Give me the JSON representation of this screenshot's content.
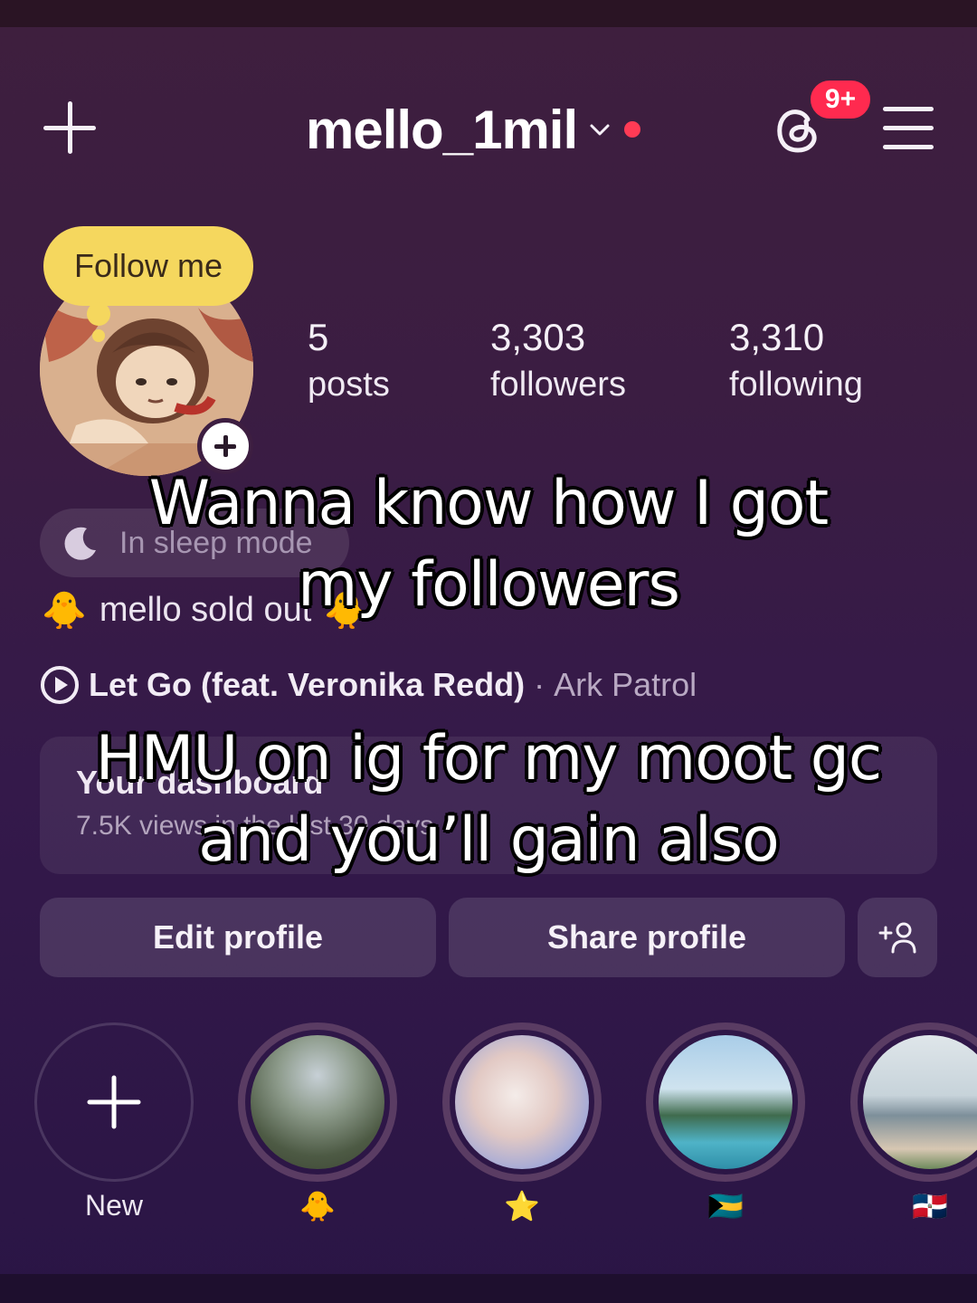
{
  "header": {
    "username": "mello_1mil",
    "threads_badge": "9+"
  },
  "note": {
    "text": "Follow me"
  },
  "stats": {
    "posts_count": "5",
    "posts_label": "posts",
    "followers_count": "3,303",
    "followers_label": "followers",
    "following_count": "3,310",
    "following_label": "following"
  },
  "status": {
    "sleep_text": "In sleep mode"
  },
  "bio": {
    "emoji_left": "🐥",
    "text": "mello sold out",
    "emoji_right": "🐥"
  },
  "music": {
    "song": "Let Go (feat. Veronika Redd)",
    "separator": "·",
    "artist": "Ark Patrol"
  },
  "dashboard": {
    "title": "Your dashboard",
    "subtitle": "7.5K views in the last 30 days"
  },
  "actions": {
    "edit_label": "Edit profile",
    "share_label": "Share profile"
  },
  "highlights": [
    {
      "label": "New"
    },
    {
      "label": "🐥"
    },
    {
      "label": "⭐"
    },
    {
      "label": "🇧🇸"
    },
    {
      "label": "🇩🇴"
    }
  ],
  "overlay": {
    "line1": "Wanna know how I got",
    "line2": "my followers",
    "line3": "HMU on ig for my moot gc",
    "line4": "and you’ll gain also"
  },
  "colors": {
    "badge": "#ff2a4f",
    "note_bg": "#f5d75e",
    "background": "#3b1d42"
  }
}
